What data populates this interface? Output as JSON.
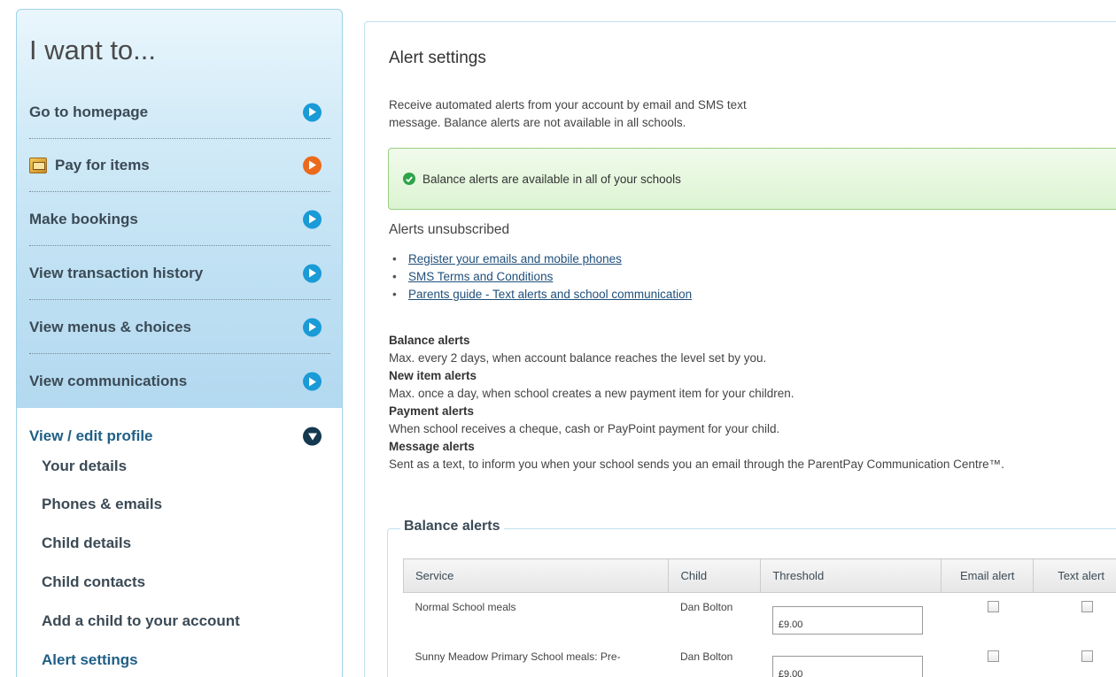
{
  "sidebar": {
    "title": "I want to...",
    "items": [
      {
        "label": "Go to homepage"
      },
      {
        "label": "Pay for items"
      },
      {
        "label": "Make bookings"
      },
      {
        "label": "View transaction history"
      },
      {
        "label": "View menus & choices"
      },
      {
        "label": "View communications"
      }
    ],
    "profile": {
      "label": "View / edit profile",
      "sub_items": [
        {
          "label": "Your details"
        },
        {
          "label": "Phones & emails"
        },
        {
          "label": "Child details"
        },
        {
          "label": "Child contacts"
        },
        {
          "label": "Add a child to your account"
        },
        {
          "label": "Alert settings"
        }
      ]
    }
  },
  "main": {
    "title": "Alert settings",
    "intro_line1": "Receive automated alerts from your account by email and SMS text",
    "intro_line2": "message. Balance alerts are not available in all schools.",
    "success_message": "Balance alerts are available in all of your schools",
    "unsub_title": "Alerts unsubscribed",
    "links": [
      "Register your emails and mobile phones",
      "SMS Terms and Conditions",
      "Parents guide - Text alerts and school communication"
    ],
    "alert_types": [
      {
        "heading": "Balance alerts",
        "text": "Max. every 2 days, when account balance reaches the level set by you."
      },
      {
        "heading": "New item alerts",
        "text": "Max. once a day, when school creates a new payment item for your children."
      },
      {
        "heading": "Payment alerts",
        "text": "When school receives a cheque, cash or PayPoint payment for your child."
      },
      {
        "heading": "Message alerts",
        "text": "Sent as a text, to inform you when your school sends you an email through the ParentPay Communication Centre™."
      }
    ],
    "balance_alerts": {
      "legend": "Balance alerts",
      "columns": [
        "Service",
        "Child",
        "Threshold",
        "Email alert",
        "Text alert"
      ],
      "rows": [
        {
          "service": "Normal School meals",
          "child": "Dan Bolton",
          "threshold": "£9.00"
        },
        {
          "service": "Sunny Meadow Primary School meals: Pre-",
          "child": "Dan Bolton",
          "threshold": "£9.00"
        }
      ]
    }
  }
}
